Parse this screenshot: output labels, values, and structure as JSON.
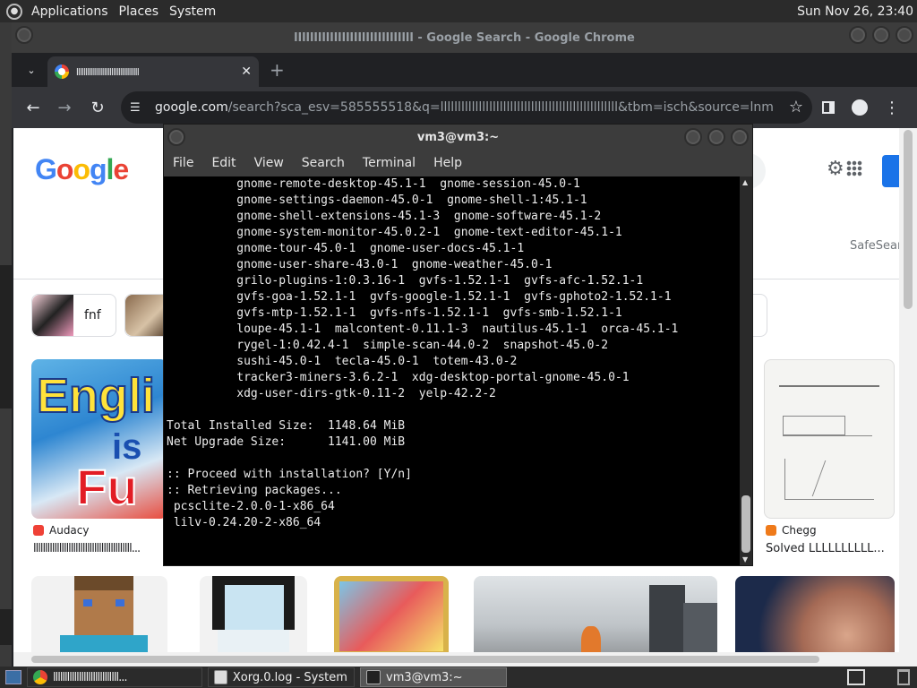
{
  "top_panel": {
    "menus": [
      "Applications",
      "Places",
      "System"
    ],
    "clock": "Sun Nov 26, 23:40"
  },
  "chrome": {
    "window_title": "llllllllllllllllllllllllllllll - Google Search - Google Chrome",
    "tab_title": "llllllllllllllllllllllllllllllllll",
    "url_host": "google.com",
    "url_rest": "/search?sca_esv=585555518&q=lllllllllllllllllllllllllllllllllllllllllllllllllll&tbm=isch&source=lnms&sa...",
    "icons": {
      "back": "back-arrow-icon",
      "forward": "forward-arrow-icon",
      "reload": "reload-icon",
      "site_info": "tune-icon",
      "bookmark": "star-icon",
      "side_panel": "side-panel-icon",
      "profile": "profile-icon",
      "menu": "kebab-menu-icon"
    }
  },
  "google": {
    "logo": [
      "G",
      "o",
      "o",
      "g",
      "l",
      "e"
    ],
    "safesearch": "SafeSear",
    "chips": [
      {
        "label": "fnf"
      },
      {
        "label": ""
      }
    ],
    "results": [
      {
        "source": "Audacy",
        "caption": "llllllllllllllllllllllllllllllllllllllllll...",
        "source_color": "#ef4136"
      },
      {
        "source": "Chegg",
        "caption": "Solved LLLLLLLLLL...",
        "source_color": "#ef7a1a"
      }
    ]
  },
  "terminal": {
    "title": "vm3@vm3:~",
    "menu": [
      "File",
      "Edit",
      "View",
      "Search",
      "Terminal",
      "Help"
    ],
    "lines": [
      "          gnome-remote-desktop-45.1-1  gnome-session-45.0-1",
      "          gnome-settings-daemon-45.0-1  gnome-shell-1:45.1-1",
      "          gnome-shell-extensions-45.1-3  gnome-software-45.1-2",
      "          gnome-system-monitor-45.0.2-1  gnome-text-editor-45.1-1",
      "          gnome-tour-45.0-1  gnome-user-docs-45.1-1",
      "          gnome-user-share-43.0-1  gnome-weather-45.0-1",
      "          grilo-plugins-1:0.3.16-1  gvfs-1.52.1-1  gvfs-afc-1.52.1-1",
      "          gvfs-goa-1.52.1-1  gvfs-google-1.52.1-1  gvfs-gphoto2-1.52.1-1",
      "          gvfs-mtp-1.52.1-1  gvfs-nfs-1.52.1-1  gvfs-smb-1.52.1-1",
      "          loupe-45.1-1  malcontent-0.11.1-3  nautilus-45.1-1  orca-45.1-1",
      "          rygel-1:0.42.4-1  simple-scan-44.0-2  snapshot-45.0-2",
      "          sushi-45.0-1  tecla-45.0-1  totem-43.0-2",
      "          tracker3-miners-3.6.2-1  xdg-desktop-portal-gnome-45.0-1",
      "          xdg-user-dirs-gtk-0.11-2  yelp-42.2-2",
      "",
      "Total Installed Size:  1148.64 MiB",
      "Net Upgrade Size:      1141.00 MiB",
      "",
      ":: Proceed with installation? [Y/n]",
      ":: Retrieving packages...",
      " pcsclite-2.0.0-1-x86_64",
      " lilv-0.24.20-2-x86_64"
    ]
  },
  "taskbar": {
    "tasks": [
      {
        "label": "llllllllllllllllllllllllllll...",
        "icon": "chrome-icon"
      },
      {
        "label": "Xorg.0.log - System...",
        "icon": "log-viewer-icon"
      },
      {
        "label": "vm3@vm3:~",
        "icon": "terminal-icon"
      }
    ]
  }
}
